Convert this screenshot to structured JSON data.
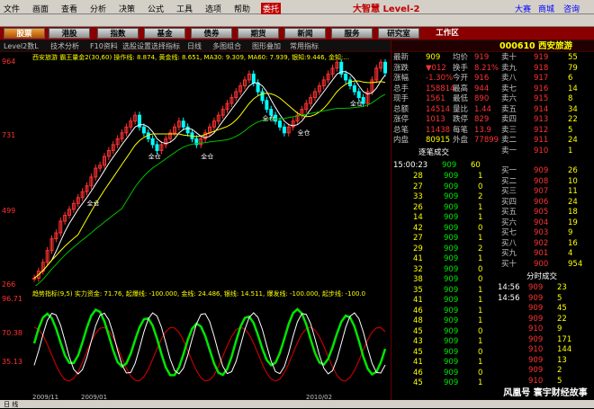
{
  "menu": {
    "items": [
      "文件",
      "画面",
      "查看",
      "分析",
      "决策",
      "公式",
      "工具",
      "选项",
      "帮助"
    ],
    "logo": "大智慧 Level-2",
    "right": [
      "大赛",
      "商城",
      "咨询"
    ],
    "badge": "委托"
  },
  "nav": [
    "股票",
    "港股",
    "指数",
    "基金",
    "债券",
    "期货",
    "新闻",
    "服务",
    "研究室",
    "工作区"
  ],
  "sub": {
    "items": [
      "Level2数L",
      "技术分析",
      "F10资料",
      "选股设置",
      "选择指标",
      "日线",
      "多图组合",
      "图形叠加",
      "常用指标"
    ]
  },
  "chart": {
    "title": "西安旅游 霸王量金2(30,60) 操作线: 8.874, 黄金线: 8.651, MA30: 9.309, MA60: 7.939, 银知:9.446, 金知:...",
    "price_ticks": [
      "964",
      "731",
      "499",
      "266"
    ],
    "sub_title": "趋势指标(9,5) 实力资金: 71.76, 起爆线: -100.000, 金线: 24.486, 银线: 14.511, 爆发线: -100.000, 起步线: -100.0",
    "sub_ticks": [
      "96.71",
      "70.38",
      "35.13"
    ],
    "axis_dates": [
      "2009/11",
      "2009/01",
      "2010/02"
    ],
    "labels": [
      "全仓",
      "全仓",
      "全仓",
      "全仓",
      "全仓",
      "全仓"
    ],
    "price_series": [
      266,
      290,
      320,
      360,
      400,
      420,
      460,
      480,
      500,
      520,
      540,
      560,
      580,
      610,
      640,
      650,
      680,
      700,
      720,
      740,
      760,
      780,
      800,
      820,
      780,
      760,
      740,
      720,
      700,
      720,
      740,
      760,
      780,
      800,
      780,
      760,
      740,
      720,
      740,
      760,
      780,
      800,
      820,
      840,
      860,
      880,
      900,
      920,
      940,
      960,
      930,
      900,
      870,
      840,
      820,
      800,
      780,
      760,
      780,
      800,
      820,
      840,
      860,
      880,
      900,
      920,
      940,
      960,
      980,
      1000,
      960,
      940,
      920,
      900,
      880,
      860,
      900,
      940,
      980,
      1000,
      964
    ]
  },
  "quote": {
    "code": "000610 西安旅游",
    "rows": [
      [
        "最新",
        "909",
        "均价",
        "919"
      ],
      [
        "涨跌",
        "▼012",
        "换手",
        "8.21%"
      ],
      [
        "涨幅",
        "-1.30%",
        "今开",
        "916"
      ],
      [
        "总手",
        "158814",
        "最高",
        "944"
      ],
      [
        "现手",
        "1561",
        "最低",
        "890"
      ],
      [
        "总额",
        "14514",
        "量比",
        "1.44"
      ],
      [
        "涨停",
        "1013",
        "跌停",
        "829"
      ],
      [
        "总笔",
        "11438",
        "每笔",
        "13.9"
      ],
      [
        "内盘",
        "80915",
        "外盘",
        "77899"
      ]
    ],
    "sell": [
      [
        "卖十",
        "919",
        "55"
      ],
      [
        "卖九",
        "918",
        "79"
      ],
      [
        "卖八",
        "917",
        "6"
      ],
      [
        "卖七",
        "916",
        "14"
      ],
      [
        "卖六",
        "915",
        "8"
      ],
      [
        "卖五",
        "914",
        "34"
      ],
      [
        "卖四",
        "913",
        "22"
      ],
      [
        "卖三",
        "912",
        "5"
      ],
      [
        "卖二",
        "911",
        "24"
      ],
      [
        "卖一",
        "910",
        "1"
      ]
    ],
    "buy": [
      [
        "买一",
        "909",
        "26"
      ],
      [
        "买二",
        "908",
        "10"
      ],
      [
        "买三",
        "907",
        "11"
      ],
      [
        "买四",
        "906",
        "24"
      ],
      [
        "买五",
        "905",
        "18"
      ],
      [
        "买六",
        "904",
        "19"
      ],
      [
        "买七",
        "903",
        "9"
      ],
      [
        "买八",
        "902",
        "16"
      ],
      [
        "买九",
        "901",
        "4"
      ],
      [
        "买十",
        "900",
        "954"
      ]
    ],
    "ticks_title": "逐笔成交",
    "ticks_time": "15:00:23",
    "ticks": [
      [
        "28",
        "909",
        "1"
      ],
      [
        "27",
        "909",
        "0"
      ],
      [
        "33",
        "909",
        "2"
      ],
      [
        "26",
        "909",
        "1"
      ],
      [
        "14",
        "909",
        "1"
      ],
      [
        "42",
        "909",
        "0"
      ],
      [
        "27",
        "909",
        "1"
      ],
      [
        "29",
        "909",
        "2"
      ],
      [
        "41",
        "909",
        "1"
      ],
      [
        "32",
        "909",
        "0"
      ],
      [
        "38",
        "909",
        "0"
      ],
      [
        "35",
        "909",
        "1"
      ],
      [
        "41",
        "909",
        "1"
      ],
      [
        "46",
        "909",
        "1"
      ],
      [
        "48",
        "909",
        "1"
      ],
      [
        "45",
        "909",
        "0"
      ],
      [
        "43",
        "909",
        "1"
      ],
      [
        "45",
        "909",
        "0"
      ],
      [
        "41",
        "909",
        "1"
      ],
      [
        "46",
        "909",
        "0"
      ],
      [
        "45",
        "909",
        "1"
      ]
    ],
    "min_title": "分时成交",
    "mins": [
      [
        "14:56",
        "909",
        "23"
      ],
      [
        "14:56",
        "909",
        "5"
      ],
      [
        "",
        "909",
        "45"
      ],
      [
        "",
        "909",
        "22"
      ],
      [
        "",
        "910",
        "9"
      ],
      [
        "",
        "909",
        "171"
      ],
      [
        "",
        "910",
        "144"
      ],
      [
        "",
        "909",
        "13"
      ],
      [
        "",
        "909",
        "2"
      ],
      [
        "",
        "910",
        "5"
      ]
    ]
  },
  "status": {
    "left": "日 线",
    "watermark": "风凰号 寰宇财经故事"
  }
}
